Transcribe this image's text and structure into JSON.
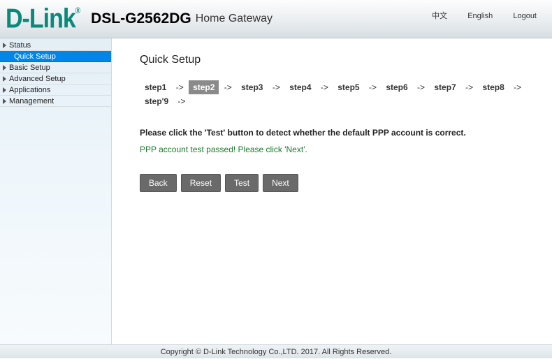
{
  "header": {
    "brand": "D-Link",
    "brand_reg": "®",
    "model": "DSL-G2562DG",
    "model_sub": "Home Gateway",
    "links": {
      "chinese": "中文",
      "english": "English",
      "logout": "Logout"
    }
  },
  "sidebar": {
    "items": [
      {
        "label": "Status"
      },
      {
        "label": "Quick Setup",
        "sub": true,
        "active": true
      },
      {
        "label": "Basic Setup"
      },
      {
        "label": "Advanced Setup"
      },
      {
        "label": "Applications"
      },
      {
        "label": "Management"
      }
    ]
  },
  "main": {
    "title": "Quick Setup",
    "steps": [
      "step1",
      "step2",
      "step3",
      "step4",
      "step5",
      "step6",
      "step7",
      "step8",
      "step'9"
    ],
    "active_step_index": 1,
    "arrow": "->",
    "instruction": "Please click the 'Test' button to detect whether the default PPP account is correct.",
    "result": "PPP account test passed! Please click 'Next'.",
    "buttons": {
      "back": "Back",
      "reset": "Reset",
      "test": "Test",
      "next": "Next"
    }
  },
  "footer": {
    "text": "Copyright © D-Link Technology Co.,LTD. 2017. All Rights Reserved."
  }
}
